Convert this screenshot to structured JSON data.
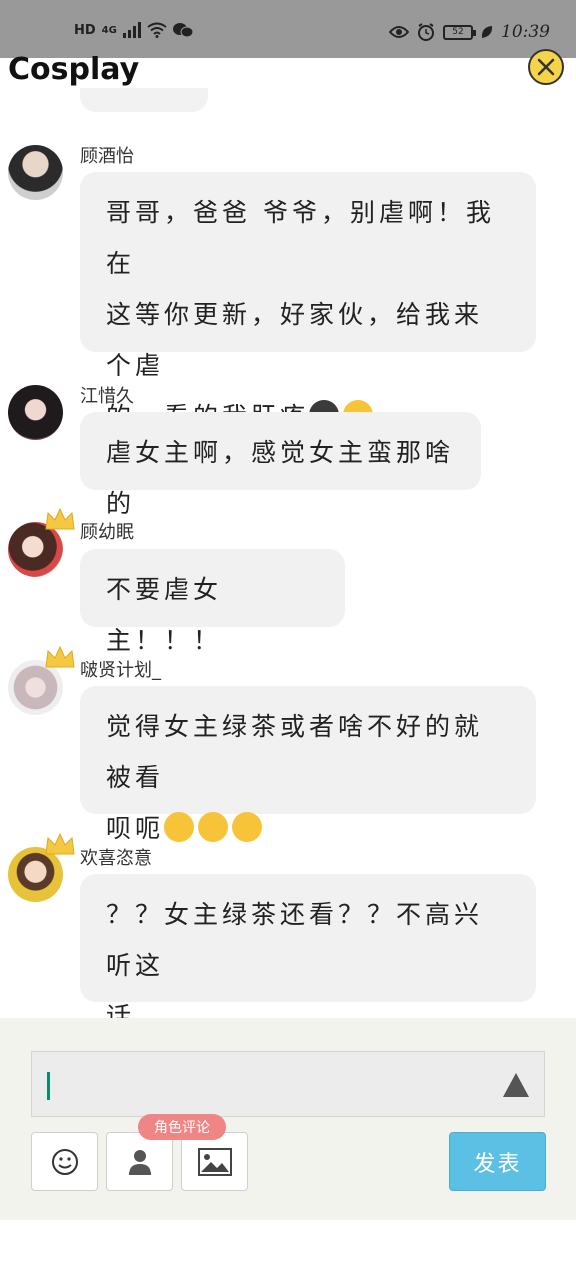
{
  "status_bar": {
    "left_badges": [
      "HD",
      "4G"
    ],
    "battery": "52",
    "time": "10:39"
  },
  "header": {
    "title": "Cosplay",
    "close_icon": "close-icon"
  },
  "comments": [
    {
      "name": "顾酒怡",
      "lines": [
        "哥哥，爸爸 爷爷，别虐啊！我在",
        "这等你更新，好家伙，给我来个虐",
        "的，看的我肝疼"
      ],
      "emojis": [
        "smiling-face-with-horns-emoji",
        "upside-down-face-emoji"
      ],
      "has_crown": false
    },
    {
      "name": "江惜久",
      "lines": [
        "虐女主啊，感觉女主蛮那啥的"
      ],
      "has_crown": false
    },
    {
      "name": "顾幼眠",
      "lines": [
        "不要虐女主！！！"
      ],
      "has_crown": true
    },
    {
      "name": "啵贤计划_",
      "lines": [
        "觉得女主绿茶或者啥不好的就被看",
        "呗呃"
      ],
      "emojis": [
        "grinning-sweat-emoji",
        "grinning-sweat-emoji",
        "grinning-sweat-emoji"
      ],
      "has_crown": true
    },
    {
      "name": "欢喜恣意",
      "lines": [
        "？？女主绿茶还看？？不高兴听这",
        "话。"
      ],
      "has_crown": true
    }
  ],
  "composer": {
    "input_value": "",
    "role_tag": "角色评论",
    "send_label": "发表",
    "tools": [
      "emoji-icon",
      "person-icon",
      "image-icon"
    ]
  },
  "colors": {
    "status_bar": "#999999",
    "bubble": "#f1f1f2",
    "send_button": "#5bc0e3",
    "role_tag": "#ef8584",
    "crown": "#f5c842",
    "close_button": "#f5d547"
  }
}
